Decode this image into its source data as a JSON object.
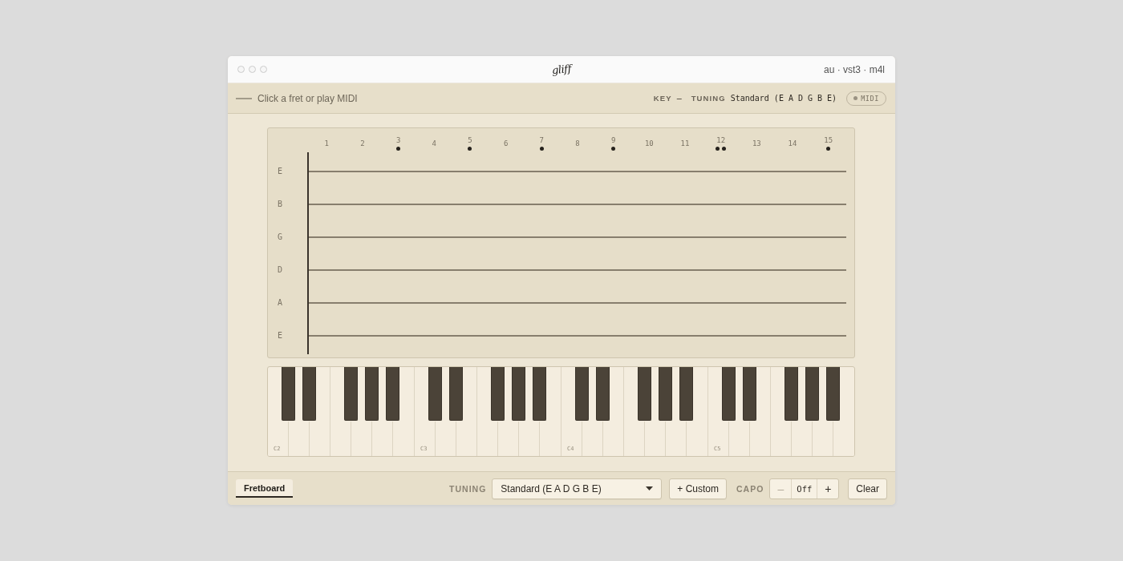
{
  "window": {
    "title": "gliff",
    "formats": "au · vst3 · m4l"
  },
  "toolbar": {
    "hint": "Click a fret or play MIDI",
    "readouts": [
      {
        "label": "KEY",
        "value": "–"
      },
      {
        "label": "TUNING",
        "value": "Standard (E A D G B E)"
      }
    ],
    "midi": {
      "label": "MIDI",
      "connected": false
    }
  },
  "fretboard": {
    "frets": [
      {
        "label": "1",
        "kind": "plain"
      },
      {
        "label": "2",
        "kind": "plain"
      },
      {
        "label": "3",
        "kind": "inlay"
      },
      {
        "label": "4",
        "kind": "plain"
      },
      {
        "label": "5",
        "kind": "inlay"
      },
      {
        "label": "6",
        "kind": "plain"
      },
      {
        "label": "7",
        "kind": "inlay"
      },
      {
        "label": "8",
        "kind": "plain"
      },
      {
        "label": "9",
        "kind": "inlay"
      },
      {
        "label": "10",
        "kind": "plain"
      },
      {
        "label": "11",
        "kind": "plain"
      },
      {
        "label": "12",
        "kind": "double"
      },
      {
        "label": "13",
        "kind": "plain"
      },
      {
        "label": "14",
        "kind": "plain"
      },
      {
        "label": "15",
        "kind": "inlay"
      }
    ],
    "strings": [
      {
        "label": "E"
      },
      {
        "label": "B"
      },
      {
        "label": "G"
      },
      {
        "label": "D"
      },
      {
        "label": "A"
      },
      {
        "label": "E"
      }
    ]
  },
  "piano": {
    "octaves": [
      {
        "label": "C2"
      },
      {
        "label": "C3"
      },
      {
        "label": "C4"
      },
      {
        "label": "C5"
      }
    ]
  },
  "bottom_bar": {
    "tabs": [
      {
        "label": "Fretboard",
        "selected": true
      }
    ],
    "tuning": {
      "label": "TUNING",
      "value": "Standard (E A D G B E)"
    },
    "custom_button": "+ Custom",
    "capo": {
      "label": "CAPO",
      "decrement": {
        "label": "–",
        "disabled": true
      },
      "value": "Off",
      "increment": {
        "label": "+",
        "disabled": false
      }
    },
    "clear_button": "Clear"
  }
}
